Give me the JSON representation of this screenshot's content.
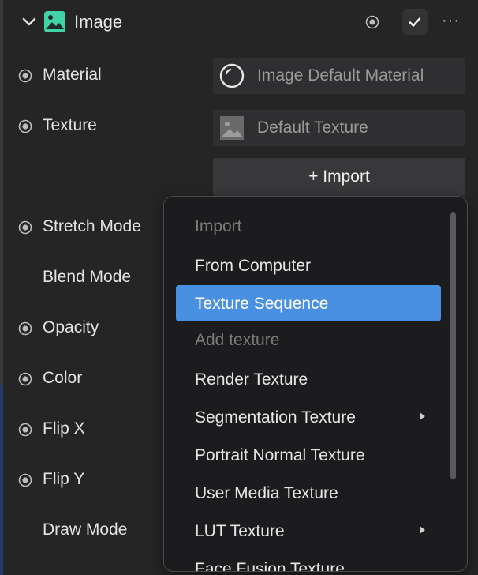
{
  "header": {
    "title": "Image",
    "more_glyph": "···",
    "icons": {
      "toggle": "chevron-down-icon",
      "component": "image-icon",
      "target": "radio-target-icon",
      "enabled": "checkmark-icon",
      "more": "more-horizontal-icon"
    }
  },
  "properties": [
    {
      "label": "Material"
    },
    {
      "label": "Texture"
    },
    {
      "label": "Stretch Mode"
    },
    {
      "label": "Blend Mode"
    },
    {
      "label": "Opacity"
    },
    {
      "label": "Color"
    },
    {
      "label": "Flip X"
    },
    {
      "label": "Flip Y"
    },
    {
      "label": "Draw Mode"
    }
  ],
  "material_field": {
    "value": "Image Default Material",
    "icon": "material-circle-icon"
  },
  "texture_field": {
    "value": "Default Texture",
    "icon": "texture-thumbnail-icon"
  },
  "import_button": {
    "label": "+ Import"
  },
  "menu": {
    "items": [
      {
        "label": "Import",
        "state": "disabled"
      },
      {
        "label": "From Computer",
        "state": "normal"
      },
      {
        "label": "Texture Sequence",
        "state": "selected"
      },
      {
        "label": "Add texture",
        "state": "disabled"
      },
      {
        "label": "Render Texture",
        "state": "normal"
      },
      {
        "label": "Segmentation Texture",
        "state": "normal",
        "submenu": true
      },
      {
        "label": "Portrait Normal Texture",
        "state": "normal"
      },
      {
        "label": "User Media Texture",
        "state": "normal"
      },
      {
        "label": "LUT Texture",
        "state": "normal",
        "submenu": true
      },
      {
        "label": "Face Fusion Texture",
        "state": "normal"
      }
    ]
  },
  "colors": {
    "panel_bg": "#252526",
    "menu_bg": "#1c1c1e",
    "selected": "#4a90e2",
    "accent_icon": "#3fd3a7",
    "disabled_text": "#7b7b7b"
  }
}
